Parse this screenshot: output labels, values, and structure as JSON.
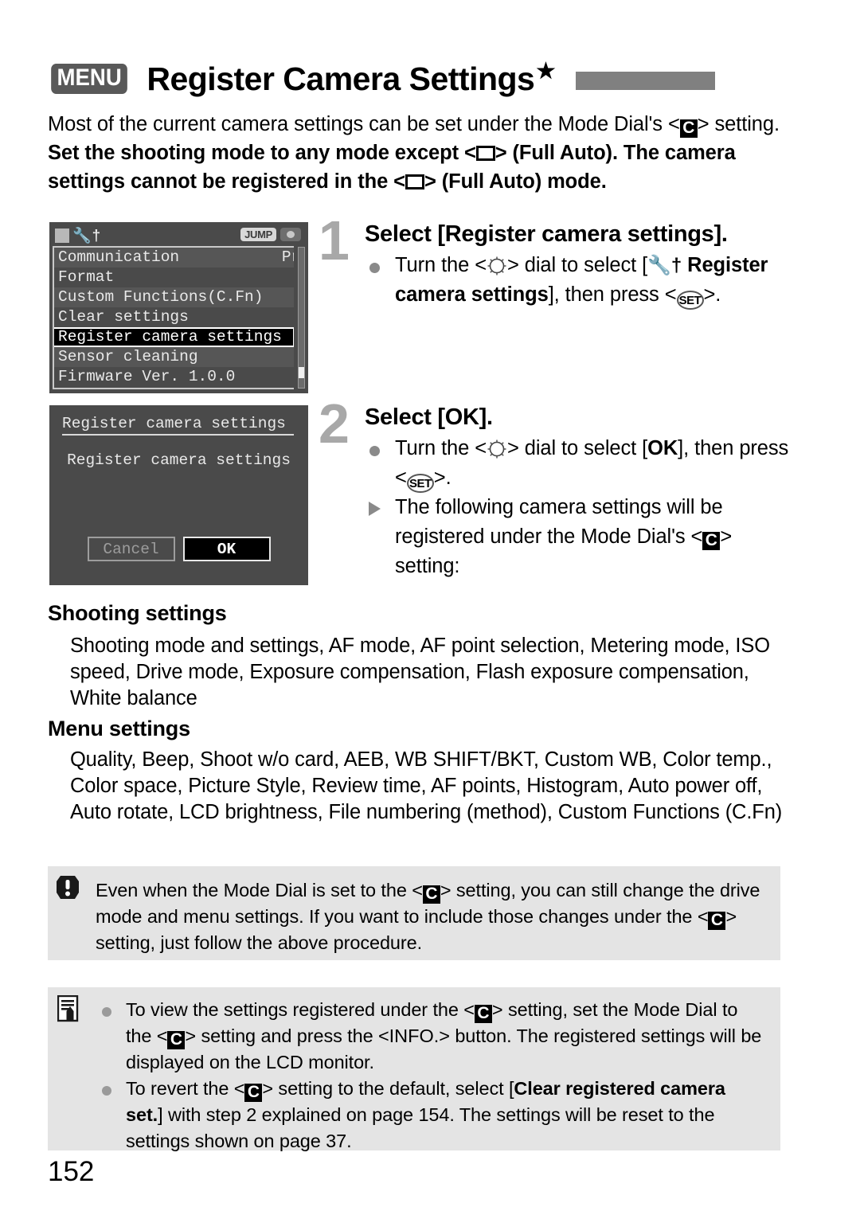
{
  "header": {
    "menu_badge": "MENU",
    "title": "Register Camera Settings",
    "star": "★"
  },
  "intro": {
    "part1": "Most of the current camera settings can be set under the Mode Dial's <",
    "icon1": "C",
    "part2": "> setting. ",
    "bold1": "Set the shooting mode to any mode except <",
    "bold2": "> (Full Auto). The camera settings cannot be registered in the <",
    "bold3": "> (Full Auto) mode."
  },
  "lcd_menu": {
    "tab_icon": "tools-tab",
    "jump_label": "JUMP",
    "camera_icon": "camera-icon",
    "items": [
      {
        "label": "Communication",
        "value": "Print/PTP",
        "selected": false
      },
      {
        "label": "Format",
        "value": "",
        "selected": false
      },
      {
        "label": "Custom Functions(C.Fn)",
        "value": "",
        "selected": false
      },
      {
        "label": "Clear settings",
        "value": "",
        "selected": false
      },
      {
        "label": "Register camera settings",
        "value": "",
        "selected": true
      },
      {
        "label": "Sensor cleaning",
        "value": "",
        "selected": false
      },
      {
        "label": "Firmware Ver. 1.0.0",
        "value": "",
        "selected": false
      }
    ]
  },
  "lcd_dialog": {
    "title": "Register camera settings",
    "body": "Register camera settings",
    "cancel_label": "Cancel",
    "ok_label": "OK"
  },
  "steps": [
    {
      "number": "1",
      "heading": "Select [Register camera settings].",
      "line1_a": "Turn the <",
      "line1_b": "> dial to select [",
      "line1_bold": "Register camera settings",
      "line1_c": "], then press <",
      "line1_d": ">."
    },
    {
      "number": "2",
      "heading": "Select [OK].",
      "line1_a": "Turn the <",
      "line1_b": "> dial to select [",
      "line1_ok": "OK",
      "line1_c": "], then press <",
      "line1_d": ">.",
      "line2_a": "The following camera settings will be registered under the Mode Dial's <",
      "line2_b": "> setting:"
    }
  ],
  "sections": [
    {
      "heading": "Shooting settings",
      "body": "Shooting mode and settings, AF mode, AF point selection, Metering mode, ISO speed, Drive mode, Exposure compensation, Flash exposure compensation, White balance"
    },
    {
      "heading": "Menu settings",
      "body": "Quality, Beep, Shoot w/o card, AEB, WB SHIFT/BKT, Custom WB, Color temp., Color space, Picture Style, Review time, AF points, Histogram, Auto power off, Auto rotate, LCD brightness, File numbering (method), Custom Functions (C.Fn)"
    }
  ],
  "warning_note": {
    "icon": "exclamation-icon",
    "part1": "Even when the Mode Dial is set to the <",
    "part2": "> setting, you can still change the drive mode and menu settings. If you want to include those changes under the <",
    "part3": "> setting, just follow the above procedure."
  },
  "info_note": {
    "icon": "note-pencil-icon",
    "items": [
      {
        "part1": "To view the settings registered under the <",
        "part2": "> setting, set the Mode Dial to the <",
        "part3": "> setting and press the <",
        "info_label": "INFO.",
        "part4": "> button. The registered settings will be displayed on the LCD monitor."
      },
      {
        "part1": "To revert the <",
        "part2": "> setting to the default, select [",
        "bold1": "Clear registered camera set.",
        "part3": "] with step 2 explained on page 154. The settings will be reset to the settings shown on page 37."
      }
    ]
  },
  "page_number": "152"
}
